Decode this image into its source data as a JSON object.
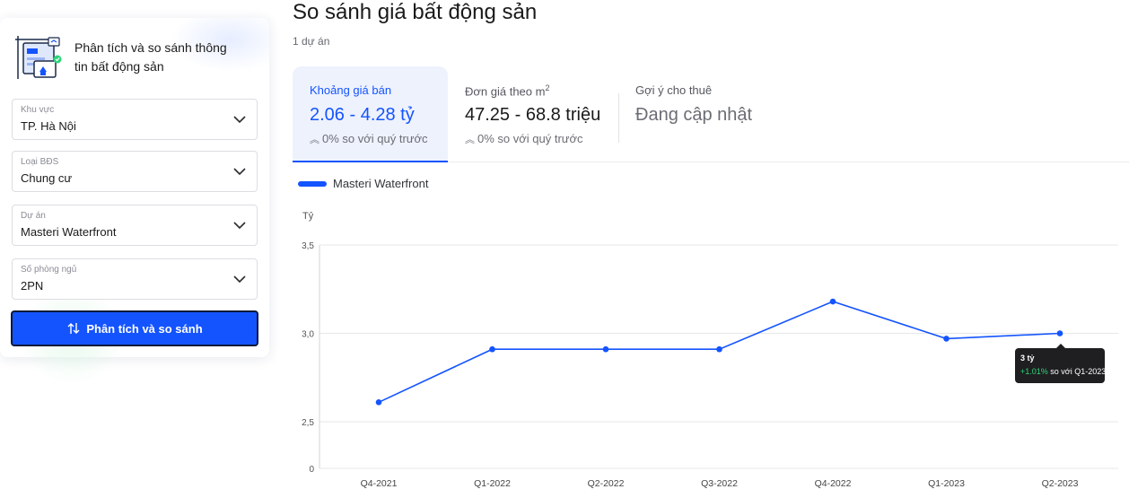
{
  "sidebar": {
    "title": "Phân tích và so sánh thông tin bất động sản",
    "fields": [
      {
        "label": "Khu vực",
        "value": "TP. Hà Nội"
      },
      {
        "label": "Loại BĐS",
        "value": "Chung cư"
      },
      {
        "label": "Dự án",
        "value": "Masteri Waterfront"
      },
      {
        "label": "Số phòng ngủ",
        "value": "2PN"
      }
    ],
    "button_label": "Phân tích và so sánh"
  },
  "main": {
    "title": "So sánh giá bất động sản",
    "project_count": "1 dự án",
    "tabs": [
      {
        "label": "Khoảng giá bán",
        "value": "2.06 - 4.28 tỷ",
        "change": "0% so với quý trước"
      },
      {
        "label": "Đơn giá theo m",
        "label_sup": "2",
        "value": "47.25 - 68.8 triệu",
        "change": "0% so với quý trước"
      },
      {
        "label": "Gợi ý cho thuê",
        "value": "Đang cập nhật"
      }
    ]
  },
  "tooltip": {
    "value": "3 tỷ",
    "change": "+1.01%",
    "suffix": " so với Q1-2023"
  },
  "colors": {
    "accent": "#1454ff",
    "positive": "#2ed47a",
    "tooltip_bg": "#1f1f21"
  },
  "chart_data": {
    "type": "line",
    "ylabel": "Tỷ",
    "categories": [
      "Q4-2021",
      "Q1-2022",
      "Q2-2022",
      "Q3-2022",
      "Q4-2022",
      "Q1-2023",
      "Q2-2023"
    ],
    "series": [
      {
        "name": "Masteri Waterfront",
        "values": [
          2.61,
          2.91,
          2.91,
          2.91,
          3.18,
          2.97,
          3.0
        ]
      }
    ],
    "yticks": [
      0,
      2.5,
      3.0,
      3.5
    ],
    "ytick_labels": [
      "0",
      "2,5",
      "3,0",
      "3,5"
    ],
    "grid": true,
    "legend": "top-left"
  }
}
